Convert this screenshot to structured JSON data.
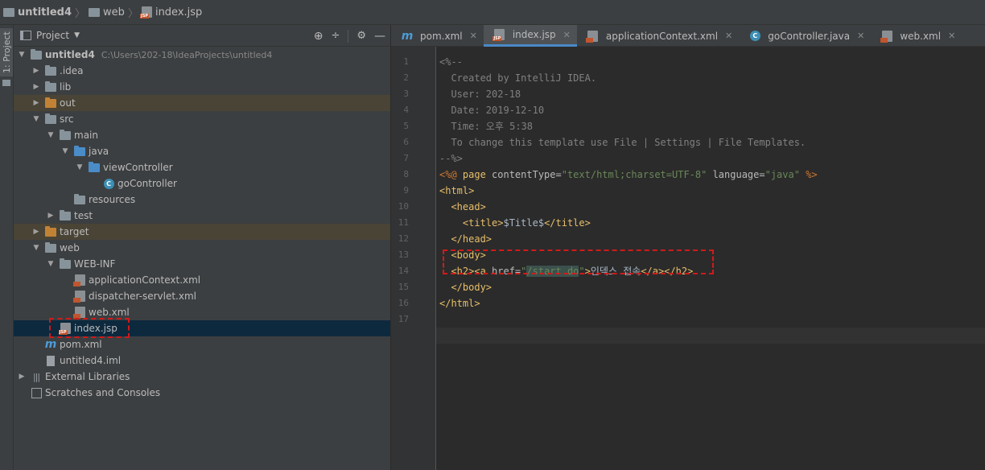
{
  "breadcrumb": {
    "project": "untitled4",
    "folder": "web",
    "file": "index.jsp"
  },
  "left_strip": {
    "label": "1: Project"
  },
  "project_panel": {
    "title": "Project",
    "tree": [
      {
        "label": "untitled4",
        "hint": "C:\\Users\\202-18\\IdeaProjects\\untitled4",
        "depth": 0,
        "arrow": "down",
        "icon": "module-folder-icon",
        "bold": true
      },
      {
        "label": ".idea",
        "depth": 1,
        "arrow": "right",
        "icon": "folder-icon"
      },
      {
        "label": "lib",
        "depth": 1,
        "arrow": "right",
        "icon": "folder-icon"
      },
      {
        "label": "out",
        "depth": 1,
        "arrow": "right",
        "icon": "excluded-folder-icon",
        "state": "excluded"
      },
      {
        "label": "src",
        "depth": 1,
        "arrow": "down",
        "icon": "folder-icon"
      },
      {
        "label": "main",
        "depth": 2,
        "arrow": "down",
        "icon": "folder-icon"
      },
      {
        "label": "java",
        "depth": 3,
        "arrow": "down",
        "icon": "source-folder-icon"
      },
      {
        "label": "viewController",
        "depth": 4,
        "arrow": "down",
        "icon": "package-icon"
      },
      {
        "label": "goController",
        "depth": 5,
        "arrow": "none",
        "icon": "class-icon"
      },
      {
        "label": "resources",
        "depth": 3,
        "arrow": "none",
        "icon": "resources-folder-icon"
      },
      {
        "label": "test",
        "depth": 2,
        "arrow": "right",
        "icon": "folder-icon"
      },
      {
        "label": "target",
        "depth": 1,
        "arrow": "right",
        "icon": "excluded-folder-icon",
        "state": "excluded"
      },
      {
        "label": "web",
        "depth": 1,
        "arrow": "down",
        "icon": "web-folder-icon"
      },
      {
        "label": "WEB-INF",
        "depth": 2,
        "arrow": "down",
        "icon": "folder-icon"
      },
      {
        "label": "applicationContext.xml",
        "depth": 3,
        "arrow": "none",
        "icon": "xml-file-icon"
      },
      {
        "label": "dispatcher-servlet.xml",
        "depth": 3,
        "arrow": "none",
        "icon": "xml-file-icon"
      },
      {
        "label": "web.xml",
        "depth": 3,
        "arrow": "none",
        "icon": "web-xml-icon"
      },
      {
        "label": "index.jsp",
        "depth": 2,
        "arrow": "none",
        "icon": "jsp-file-icon",
        "state": "selected"
      },
      {
        "label": "pom.xml",
        "depth": 1,
        "arrow": "none",
        "icon": "maven-icon"
      },
      {
        "label": "untitled4.iml",
        "depth": 1,
        "arrow": "none",
        "icon": "iml-file-icon"
      },
      {
        "label": "External Libraries",
        "depth": 0,
        "arrow": "right",
        "icon": "libraries-icon"
      },
      {
        "label": "Scratches and Consoles",
        "depth": 0,
        "arrow": "none",
        "icon": "scratches-icon"
      }
    ]
  },
  "editor": {
    "tabs": [
      {
        "label": "pom.xml",
        "icon": "maven-icon",
        "active": false
      },
      {
        "label": "index.jsp",
        "icon": "jsp-file-icon",
        "active": true
      },
      {
        "label": "applicationContext.xml",
        "icon": "xml-file-icon",
        "active": false
      },
      {
        "label": "goController.java",
        "icon": "class-icon",
        "active": false
      },
      {
        "label": "web.xml",
        "icon": "web-xml-icon",
        "active": false
      }
    ],
    "lines": [
      [
        [
          "comment",
          "<%--"
        ]
      ],
      [
        [
          "comment",
          "  Created by IntelliJ IDEA."
        ]
      ],
      [
        [
          "comment",
          "  User: 202-18"
        ]
      ],
      [
        [
          "comment",
          "  Date: 2019-12-10"
        ]
      ],
      [
        [
          "comment",
          "  Time: 오후 5:38"
        ]
      ],
      [
        [
          "comment",
          "  To change this template use File | Settings | File Templates."
        ]
      ],
      [
        [
          "comment",
          "--%>"
        ]
      ],
      [
        [
          "kw",
          "<%@ "
        ],
        [
          "tag",
          "page "
        ],
        [
          "attr",
          "contentType="
        ],
        [
          "str",
          "\"text/html;charset=UTF-8\""
        ],
        [
          "attr",
          " language="
        ],
        [
          "str",
          "\"java\""
        ],
        [
          "kw",
          " %>"
        ]
      ],
      [
        [
          "tag",
          "<html>"
        ]
      ],
      [
        [
          "plain",
          "  "
        ],
        [
          "tag",
          "<head>"
        ]
      ],
      [
        [
          "plain",
          "    "
        ],
        [
          "tag",
          "<title>"
        ],
        [
          "plain",
          "$Title$"
        ],
        [
          "tag",
          "</title>"
        ]
      ],
      [
        [
          "plain",
          "  "
        ],
        [
          "tag",
          "</head>"
        ]
      ],
      [
        [
          "plain",
          "  "
        ],
        [
          "tag",
          "<body>"
        ]
      ],
      [
        [
          "plain",
          "  "
        ],
        [
          "tag",
          "<h2><a "
        ],
        [
          "attr",
          "href="
        ],
        [
          "str",
          "\""
        ],
        [
          "hl",
          "/start.do"
        ],
        [
          "str",
          "\""
        ],
        [
          "tag",
          ">"
        ],
        [
          "plain",
          "인덱스 접속"
        ],
        [
          "tag",
          "</a></h2>"
        ]
      ],
      [
        [
          "plain",
          "  "
        ],
        [
          "tag",
          "</body>"
        ]
      ],
      [
        [
          "tag",
          "</html>"
        ]
      ],
      [
        [
          "plain",
          ""
        ]
      ]
    ]
  },
  "colors": {
    "background": "#2b2b2b",
    "panel": "#3c3f41",
    "selection": "#0d293e",
    "excluded": "#4a4436",
    "annotation": "#d11a1a",
    "tag": "#e8bf6a",
    "string": "#6a8759",
    "comment": "#808080"
  }
}
